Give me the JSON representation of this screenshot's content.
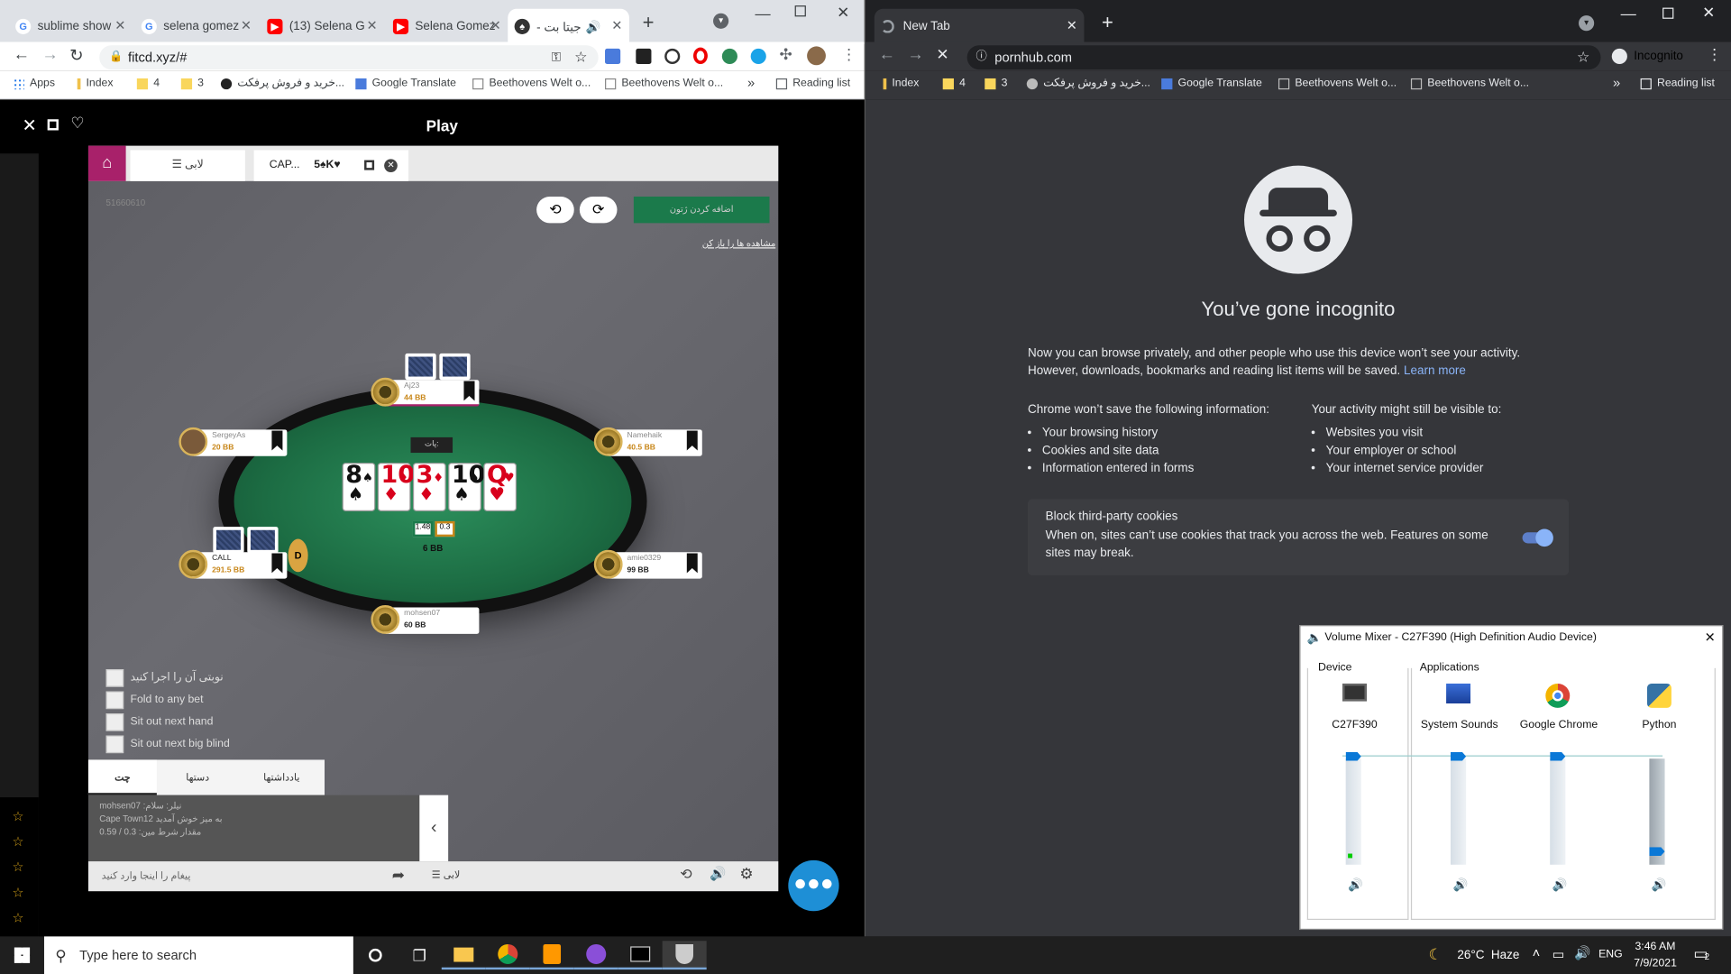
{
  "left_window": {
    "tabs": [
      {
        "title": "sublime show",
        "icon": "google-icon",
        "color": "#4285f4"
      },
      {
        "title": "selena gomez",
        "icon": "google-icon",
        "color": "#4285f4"
      },
      {
        "title": "(13) Selena G",
        "icon": "youtube-icon",
        "color": "#ff0000"
      },
      {
        "title": "Selena Gomez",
        "icon": "youtube-icon",
        "color": "#ff0000"
      },
      {
        "title": "- جیتا بت",
        "icon": "poker-icon",
        "color": "#333333"
      }
    ],
    "url": "fitcd.xyz/#",
    "bookmarks": [
      "Apps",
      "Index",
      "4",
      "3",
      "خرید و فروش پرفکت...",
      "Google Translate",
      "Beethovens Welt o...",
      "Beethovens Welt o..."
    ],
    "reading_list": "Reading list",
    "overflow": "»"
  },
  "poker": {
    "header_title": "Play",
    "lobby_tab": "لابی",
    "table_tab": "CAP...",
    "hand": "5♠K♥",
    "hand_no": "51660610",
    "top_button": "اضافه کردن ژتون",
    "link": "مشاهده ها را باز کن",
    "pot_label": "پات:",
    "pot_bb": "6 BB",
    "chip_left": "1.48",
    "chip_right": "0.3",
    "dealer": "D",
    "community": [
      {
        "rank": "8",
        "suit": "♠",
        "color": "blk"
      },
      {
        "rank": "10",
        "suit": "♦",
        "color": "red"
      },
      {
        "rank": "3",
        "suit": "♦",
        "color": "red"
      },
      {
        "rank": "10",
        "suit": "♠",
        "color": "blk"
      },
      {
        "rank": "Q",
        "suit": "♥",
        "color": "red"
      }
    ],
    "seats": [
      {
        "name": "Aj23",
        "bb": "44 BB"
      },
      {
        "name": "SergeyAs",
        "bb": "20 BB"
      },
      {
        "name": "Namehaik",
        "bb": "40.5 BB"
      },
      {
        "name": "CALL",
        "bb": "291.5 BB"
      },
      {
        "name": "amie0329",
        "bb": "99 BB"
      },
      {
        "name": "mohsen07",
        "bb": "60 BB"
      }
    ],
    "options": [
      "نوبتی آن را اجرا کنید",
      "Fold to any bet",
      "Sit out next hand",
      "Sit out next big blind"
    ],
    "chat_tabs": [
      "چت",
      "دستها",
      "یادداشتها"
    ],
    "chat_lines": [
      "mohsen07 :نیلر: سلام",
      "Cape Town12 به میز خوش آمدید",
      "مقدار شرط مین: 0.3 / 0.59"
    ],
    "chat_placeholder": "پیغام را اینجا وارد کنید",
    "lobby_footer": "لابی"
  },
  "right_window": {
    "tab_title": "New Tab",
    "url": "pornhub.com",
    "profile": "Incognito",
    "bookmarks": [
      "Index",
      "4",
      "3",
      "خرید و فروش پرفکت...",
      "Google Translate",
      "Beethovens Welt o...",
      "Beethovens Welt o..."
    ],
    "reading_list": "Reading list",
    "overflow": "»",
    "heading": "You’ve gone incognito",
    "intro": "Now you can browse privately, and other people who use this device won’t see your activity. However, downloads, bookmarks and reading list items will be saved.",
    "learn_more": "Learn more",
    "not_saved_title": "Chrome won’t save the following information:",
    "not_saved": [
      "Your browsing history",
      "Cookies and site data",
      "Information entered in forms"
    ],
    "visible_title": "Your activity might still be visible to:",
    "visible": [
      "Websites you visit",
      "Your employer or school",
      "Your internet service provider"
    ],
    "cookies_title": "Block third-party cookies",
    "cookies_desc": "When on, sites can’t use cookies that track you across the web. Features on some sites may break.",
    "toggle_on": true
  },
  "volume_mixer": {
    "title": "Volume Mixer - C27F390 (High Definition Audio Device)",
    "device_label": "Device",
    "apps_label": "Applications",
    "channels": [
      {
        "name": "C27F390",
        "level": 0.95
      },
      {
        "name": "System Sounds",
        "level": 0.95
      },
      {
        "name": "Google Chrome",
        "level": 0.95
      },
      {
        "name": "Python",
        "level": 0.05
      }
    ]
  },
  "taskbar": {
    "search_placeholder": "Type here to search",
    "weather": "26°C  Haze",
    "lang": "ENG",
    "time": "3:46 AM",
    "date": "7/9/2021",
    "notif_count": "2"
  }
}
